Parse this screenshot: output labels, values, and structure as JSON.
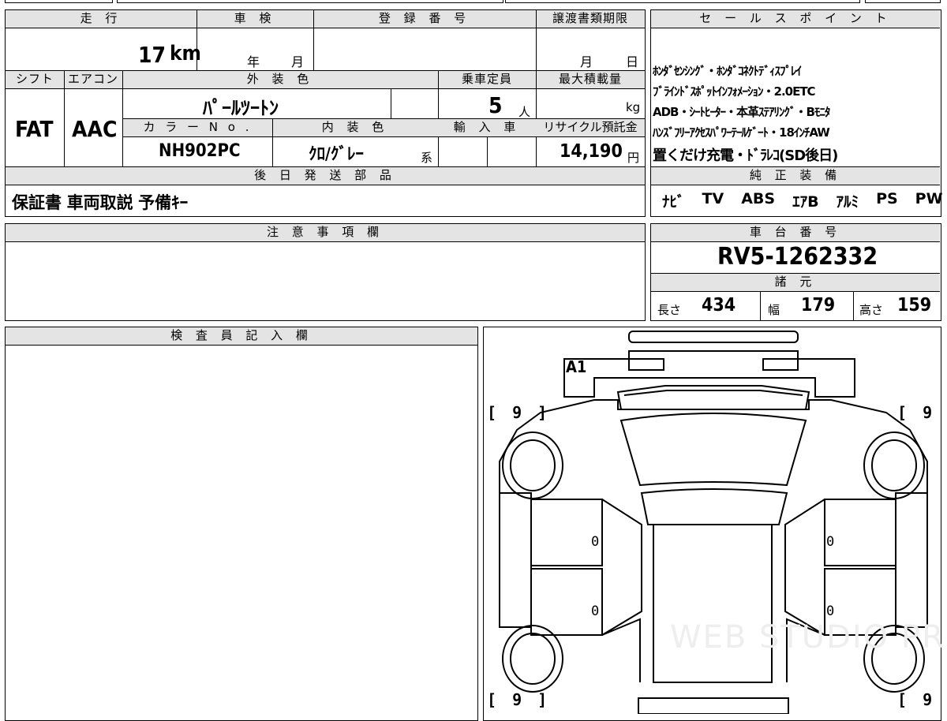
{
  "top_left": {
    "headers": {
      "mileage": "走 行",
      "inspection": "車 検",
      "registration": "登 録 番 号",
      "transfer_deadline": "譲渡書類期限",
      "shift": "シフト",
      "aircon": "エアコン",
      "exterior_color": "外 装 色",
      "capacity": "乗車定員",
      "max_load": "最大積載量",
      "color_no": "カ ラ ー N o .",
      "interior_color": "内 装 色",
      "import": "輸 入 車",
      "recycle": "リサイクル預託金",
      "later_parts": "後 日 発 送 部 品"
    },
    "mileage_value": "17",
    "mileage_unit": "km",
    "inspection_year": "年",
    "inspection_month": "月",
    "deadline_month": "月",
    "deadline_day": "日",
    "shift_value": "FAT",
    "aircon_value": "AAC",
    "exterior_color_value": "ﾊﾟｰﾙﾂｰﾄﾝ",
    "capacity_value": "5",
    "capacity_unit": "人",
    "max_load_unit": "kg",
    "color_no_value": "NH902PC",
    "interior_color_value": "ｸﾛ/ｸﾞﾚｰ",
    "interior_suffix": "系",
    "recycle_value": "14,190",
    "recycle_unit": "円",
    "later_parts_value": "保証書 車両取説 予備ｷｰ"
  },
  "sales_points": {
    "header": "セ ー ル ス ポ イ ン ト",
    "lines": [
      "ﾎﾝﾀﾞｾﾝｼﾝｸﾞ・ﾎﾝﾀﾞｺﾈｸﾄﾃﾞｨｽﾌﾟﾚｲ",
      "ﾌﾞﾗｲﾝﾄﾞｽﾎﾟｯﾄｲﾝﾌｫﾒｰｼｮﾝ・2.0ETC",
      "ADB・ｼｰﾄﾋｰﾀｰ・本革ｽﾃｱﾘﾝｸﾞ・Bﾓﾆﾀ",
      "ﾊﾝｽﾞﾌﾘｰｱｸｾｽﾊﾟﾜｰﾃｰﾙｹﾞｰﾄ・18ｲﾝﾁAW",
      "置くだけ充電・ﾄﾞﾗﾚｺ(SD後日)"
    ]
  },
  "equipment": {
    "header": "純 正 装 備",
    "items": [
      "ﾅﾋﾞ",
      "TV",
      "ABS",
      "ｴｱB",
      "ｱﾙﾐ",
      "PS",
      "PW"
    ]
  },
  "notes": {
    "header": "注 意 事 項 欄"
  },
  "chassis": {
    "header": "車 台 番 号",
    "value": "RV5-1262332"
  },
  "specs": {
    "header": "諸 元",
    "length_label": "長さ",
    "length_value": "434",
    "width_label": "幅",
    "width_value": "179",
    "height_label": "高さ",
    "height_value": "159"
  },
  "inspector": {
    "header": "検 査 員 記 入 欄"
  },
  "diagram": {
    "mark_a1": "A1",
    "bracket_fl": "[ 9 ]",
    "bracket_fr": "[ 9 ]",
    "bracket_rl": "[ 9 ]",
    "bracket_rr": "[ 9 ]",
    "door_fl": "0",
    "door_rl": "0",
    "door_fr": "0",
    "door_rr": "0",
    "watermark": "WEB STUDIO PRO"
  }
}
